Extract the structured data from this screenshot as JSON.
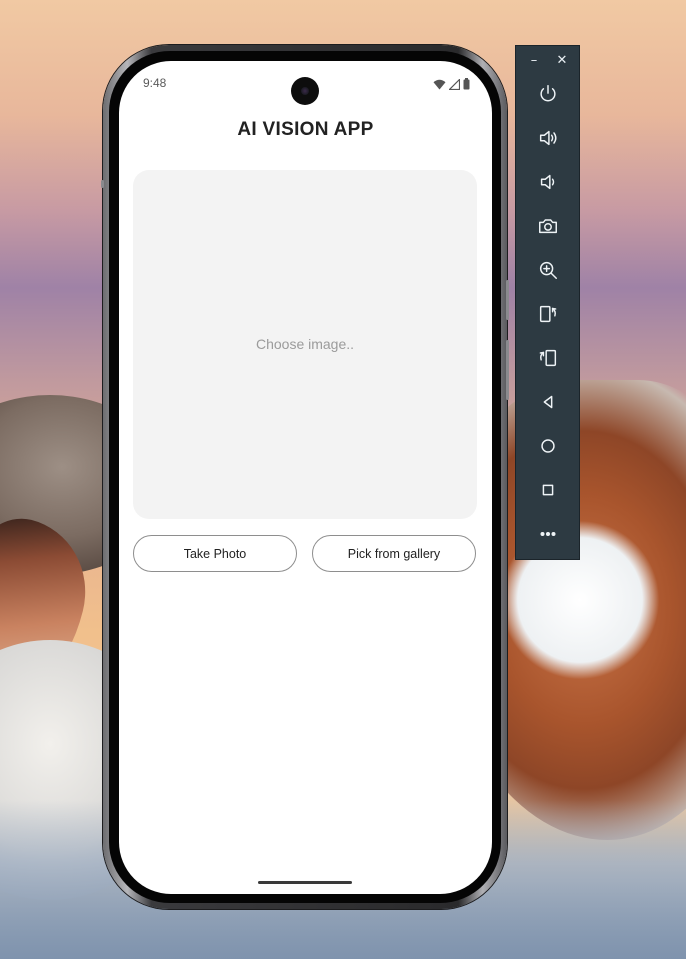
{
  "status_bar": {
    "time": "9:48",
    "icons": [
      "wifi-icon",
      "cellular-signal-icon",
      "battery-icon"
    ]
  },
  "app": {
    "title": "AI VISION APP",
    "image_placeholder_text": "Choose image..",
    "take_photo_label": "Take Photo",
    "pick_gallery_label": "Pick from gallery"
  },
  "emulator_toolbar": {
    "minimize_label": "–",
    "close_label": "✕",
    "buttons": [
      "power-icon",
      "volume-up-icon",
      "volume-down-icon",
      "camera-icon",
      "zoom-in-icon",
      "rotate-left-icon",
      "rotate-right-icon",
      "back-icon",
      "home-icon",
      "overview-icon",
      "more-icon"
    ]
  },
  "colors": {
    "screen_bg": "#ffffff",
    "placeholder_bg": "#f3f3f3",
    "toolbar_bg": "#2d3a42",
    "button_border": "#8e8e8e"
  }
}
